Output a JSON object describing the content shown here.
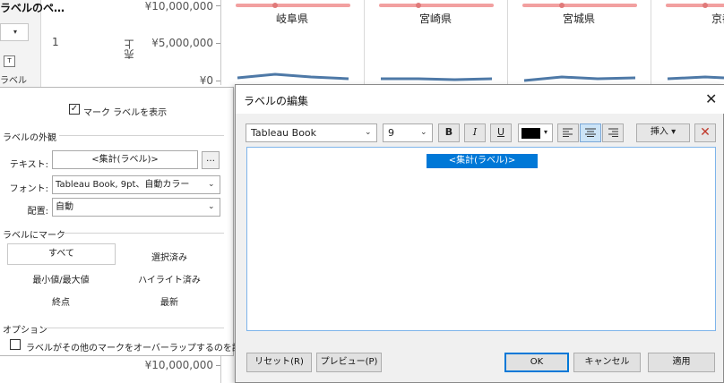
{
  "worksheet": {
    "left_strip": {
      "title": "ラベルのペ…",
      "icon_text": "T",
      "label": "ラベル"
    },
    "row_number": "1",
    "axis_title": "売上",
    "ticks": [
      "¥10,000,000",
      "¥5,000,000",
      "¥0"
    ],
    "bottom_tick": "¥10,000,000",
    "panes": [
      "岐阜県",
      "宮崎県",
      "宮城県",
      "京都"
    ],
    "colors": {
      "reference_line": "#f2a0a0",
      "trend_line": "#4e79a7"
    }
  },
  "mark_label_panel": {
    "show_labels": {
      "label": "マーク ラベルを表示",
      "checked": true
    },
    "appearance": {
      "section": "ラベルの外観",
      "text_label": "テキスト:",
      "text_value": "<集計(ラベル)>",
      "ellipsis": "…",
      "font_label": "フォント:",
      "font_value": "Tableau Book, 9pt、自動カラー",
      "align_label": "配置:",
      "align_value": "自動"
    },
    "label_marks": {
      "section": "ラベルにマーク",
      "options": [
        "すべて",
        "選択済み",
        "最小値/最大値",
        "ハイライト済み",
        "終点",
        "最新"
      ],
      "selected": "すべて"
    },
    "options": {
      "section": "オプション",
      "overlap_label": "ラベルがその他のマークをオーバーラップするのを許可",
      "overlap_checked": false
    }
  },
  "edit_dialog": {
    "title": "ラベルの編集",
    "close_icon": "close-icon",
    "font_name": "Tableau Book",
    "font_size": "9",
    "bold": "B",
    "italic": "I",
    "underline": "U",
    "text_color": "#000000",
    "align_selected": "center",
    "insert_label": "挿入 ▾",
    "clear_icon": "red-x-icon",
    "clear_color": "#c0392b",
    "content": "<集計(ラベル)>",
    "buttons": {
      "reset": "リセット(R)",
      "preview": "プレビュー(P)",
      "ok": "OK",
      "cancel": "キャンセル",
      "apply": "適用"
    }
  }
}
